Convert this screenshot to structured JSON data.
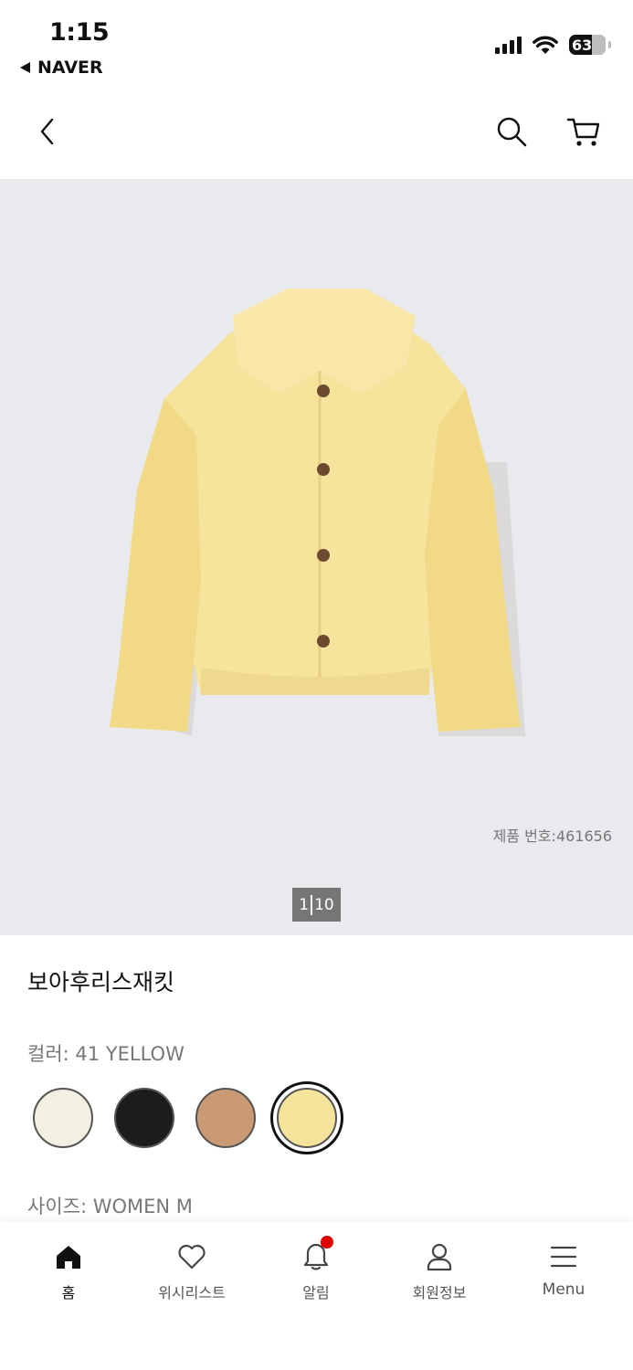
{
  "status_bar": {
    "time": "1:15",
    "back_app": "NAVER",
    "battery": "63"
  },
  "header": {
    "back_icon": "chevron-left-icon",
    "search_icon": "search-icon",
    "cart_icon": "cart-icon"
  },
  "gallery": {
    "product_number": "제품 번호:461656",
    "page_current": "1",
    "page_total": "10"
  },
  "product": {
    "title": "보아후리스재킷",
    "color_label": "컬러: 41 YELLOW",
    "swatches": [
      {
        "name": "off-white",
        "color": "#f3efe3"
      },
      {
        "name": "black",
        "color": "#1c1c1c"
      },
      {
        "name": "brown",
        "color": "#c99a73"
      },
      {
        "name": "yellow",
        "color": "#f5e39c",
        "selected": true
      }
    ],
    "size_label": "사이즈: WOMEN M"
  },
  "tabbar": {
    "items": [
      {
        "label": "홈",
        "icon": "home-icon",
        "active": true
      },
      {
        "label": "위시리스트",
        "icon": "heart-icon"
      },
      {
        "label": "알림",
        "icon": "bell-icon",
        "badge": true
      },
      {
        "label": "회원정보",
        "icon": "user-icon"
      },
      {
        "label": "Menu",
        "icon": "menu-icon"
      }
    ]
  },
  "colors": {
    "gallery_bg": "#e9eaee",
    "badge": "#e00000",
    "pager_bg": "#767676"
  }
}
